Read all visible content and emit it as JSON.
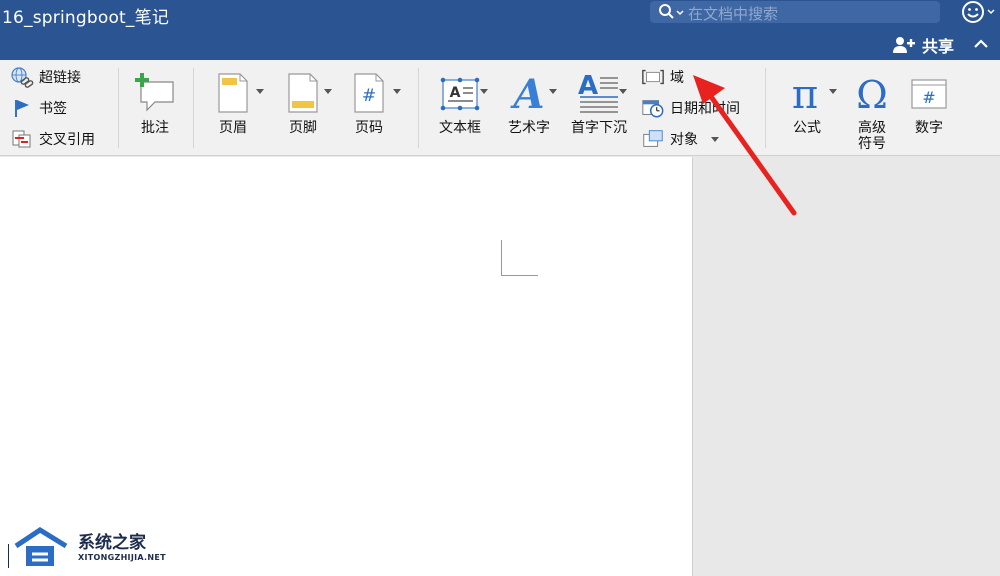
{
  "window": {
    "title": "16_springboot_笔记"
  },
  "search": {
    "placeholder": "在文档中搜索"
  },
  "header": {
    "share_label": "共享"
  },
  "ribbon": {
    "links": [
      {
        "label": "超链接",
        "icon": "hyperlink-icon"
      },
      {
        "label": "书签",
        "icon": "bookmark-flag-icon"
      },
      {
        "label": "交叉引用",
        "icon": "cross-reference-icon"
      }
    ],
    "comment": {
      "label": "批注",
      "icon": "add-comment-icon"
    },
    "header_footer": [
      {
        "label": "页眉",
        "icon": "header-icon"
      },
      {
        "label": "页脚",
        "icon": "footer-icon"
      },
      {
        "label": "页码",
        "icon": "page-number-icon"
      }
    ],
    "text": [
      {
        "label": "文本框",
        "icon": "textbox-icon"
      },
      {
        "label": "艺术字",
        "icon": "wordart-icon"
      },
      {
        "label": "首字下沉",
        "icon": "drop-cap-icon"
      }
    ],
    "field": {
      "label": "域",
      "icon": "field-icon"
    },
    "datetime": {
      "label": "日期和时间",
      "icon": "calendar-clock-icon"
    },
    "object": {
      "label": "对象",
      "icon": "object-icon"
    },
    "symbols": [
      {
        "label": "公式",
        "icon": "pi-icon"
      },
      {
        "label": "高级符号",
        "label_line1": "高级",
        "label_line2": "符号",
        "icon": "omega-icon"
      },
      {
        "label": "数字",
        "icon": "number-icon"
      }
    ]
  },
  "watermark": {
    "title": "系统之家",
    "url": "XITONGZHIJIA.NET"
  },
  "colors": {
    "titlebar": "#2b5493",
    "ribbon": "#f1f1f1",
    "accent": "#2b6cc4",
    "arrow": "#e8231f"
  }
}
